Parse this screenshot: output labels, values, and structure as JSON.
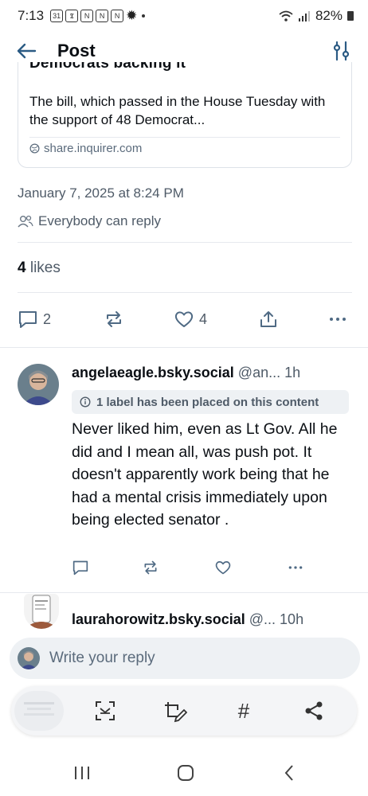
{
  "status_bar": {
    "time": "7:13",
    "battery": "82%"
  },
  "header": {
    "title": "Post"
  },
  "link_card": {
    "title_fragment": "Democrats backing it",
    "description": "The bill, which passed in the House Tuesday with the support of 48 Democrat...",
    "domain": "share.inquirer.com"
  },
  "post_meta": {
    "date": "January 7, 2025 at 8:24 PM",
    "reply_setting": "Everybody can reply",
    "likes_count": "4",
    "likes_label": "likes"
  },
  "post_actions": {
    "reply_count": "2",
    "like_count": "4"
  },
  "replies": [
    {
      "display_handle": "angelaeagle.bsky.social",
      "handle_truncated": "@an...",
      "time": "1h",
      "label_notice": "1 label has been placed on this content",
      "text": "Never liked him, even as Lt Gov. All he did and I mean all, was push pot. It doesn't apparently work being that he had a mental crisis immediately upon being elected senator ."
    },
    {
      "display_handle": "laurahorowitz.bsky.social",
      "handle_truncated": "@...",
      "time": "10h"
    }
  ],
  "composer": {
    "placeholder": "Write your reply"
  },
  "toolbar": {
    "hash_symbol": "#"
  },
  "colors": {
    "accent": "#1083fe",
    "muted_text": "#4f5b68",
    "divider": "#e6e9ee",
    "badge_bg": "#eef1f4"
  }
}
